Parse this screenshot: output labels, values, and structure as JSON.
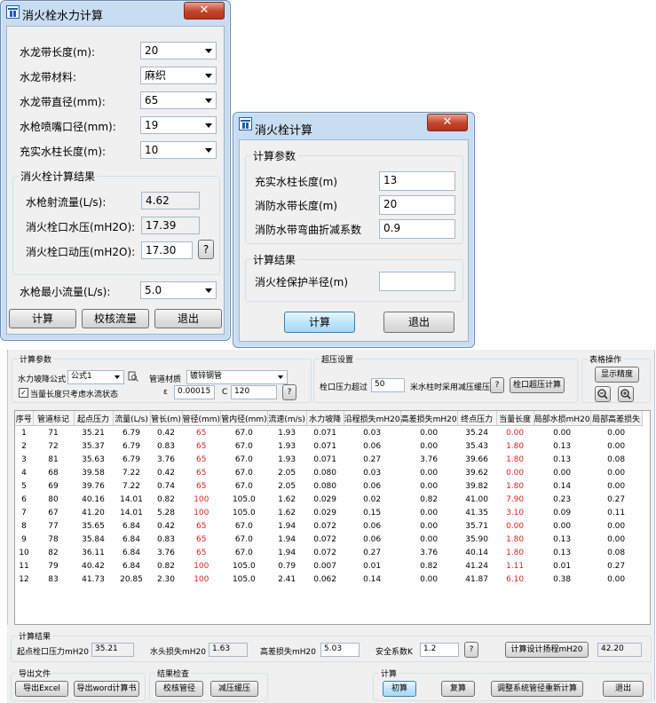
{
  "win1": {
    "title": "消火栓水力计算",
    "close": "✕",
    "hose_length": {
      "label": "水龙带长度(m):",
      "value": "20"
    },
    "hose_material": {
      "label": "水龙带材料:",
      "value": "麻织"
    },
    "hose_diameter": {
      "label": "水龙带直径(mm):",
      "value": "65"
    },
    "nozzle_diameter": {
      "label": "水枪喷嘴口径(mm):",
      "value": "19"
    },
    "water_column": {
      "label": "充实水柱长度(m):",
      "value": "10"
    },
    "results_title": "消火栓计算结果",
    "flow": {
      "label": "水枪射流量(L/s):",
      "value": "4.62"
    },
    "static_pressure": {
      "label": "消火栓口水压(mH2O):",
      "value": "17.39"
    },
    "dynamic_pressure": {
      "label": "消火栓口动压(mH2O):",
      "value": "17.30"
    },
    "help": "?",
    "min_flow": {
      "label": "水枪最小流量(L/s):",
      "value": "5.0"
    },
    "btn_calc": "计算",
    "btn_check": "校核流量",
    "btn_exit": "退出"
  },
  "win2": {
    "title": "消火栓计算",
    "close": "✕",
    "params_title": "计算参数",
    "water_column": {
      "label": "充实水柱长度(m)",
      "value": "13"
    },
    "hose_length": {
      "label": "消防水带长度(m)",
      "value": "20"
    },
    "bend_factor": {
      "label": "消防水带弯曲折减系数",
      "value": "0.9"
    },
    "results_title": "计算结果",
    "radius": {
      "label": "消火栓保护半径(m)",
      "value": ""
    },
    "btn_calc": "计算",
    "btn_exit": "退出"
  },
  "win3": {
    "params_title": "计算参数",
    "formula_label": "水力坡降公式",
    "formula_value": "公式1",
    "material_label": "管道材质",
    "material_value": "镀锌钢管",
    "checkbox_label": "当量长度只考虑水流状态",
    "eps_label": "ε",
    "eps_value": "0.00015",
    "c_label": "C",
    "c_value": "120",
    "help": "?",
    "overpressure_title": "超压设置",
    "over_label": "栓口压力超过",
    "over_value": "50",
    "over_suffix": "米水柱时采用减压缓压",
    "over_btn": "栓口超压计算",
    "table_ops_title": "表格操作",
    "btn_precision": "显示精度",
    "columns": [
      "序号",
      "管道标记",
      "起点压力",
      "流量(L/s)",
      "管长(m)",
      "管径(mm)",
      "管内径(mm)",
      "流速(m/s)",
      "水力坡降",
      "沿程损失mH20",
      "高差损失mH20",
      "终点压力",
      "当量长度",
      "局部水损mH20",
      "局部高差损失"
    ],
    "rows": [
      [
        "1",
        "71",
        "35.21",
        "6.79",
        "0.42",
        "65",
        "67.0",
        "1.93",
        "0.071",
        "0.03",
        "0.00",
        "35.24",
        "0.00",
        "0.00",
        "0.00"
      ],
      [
        "2",
        "72",
        "35.37",
        "6.79",
        "0.83",
        "65",
        "67.0",
        "1.93",
        "0.071",
        "0.06",
        "0.00",
        "35.43",
        "1.80",
        "0.13",
        "0.00"
      ],
      [
        "3",
        "81",
        "35.63",
        "6.79",
        "3.76",
        "65",
        "67.0",
        "1.93",
        "0.071",
        "0.27",
        "3.76",
        "39.66",
        "1.80",
        "0.13",
        "0.08"
      ],
      [
        "4",
        "68",
        "39.58",
        "7.22",
        "0.42",
        "65",
        "67.0",
        "2.05",
        "0.080",
        "0.03",
        "0.00",
        "39.62",
        "0.00",
        "0.00",
        "0.00"
      ],
      [
        "5",
        "69",
        "39.76",
        "7.22",
        "0.74",
        "65",
        "67.0",
        "2.05",
        "0.080",
        "0.06",
        "0.00",
        "39.82",
        "1.80",
        "0.14",
        "0.00"
      ],
      [
        "6",
        "80",
        "40.16",
        "14.01",
        "0.82",
        "100",
        "105.0",
        "1.62",
        "0.029",
        "0.02",
        "0.82",
        "41.00",
        "7.90",
        "0.23",
        "0.27"
      ],
      [
        "7",
        "67",
        "41.20",
        "14.01",
        "5.28",
        "100",
        "105.0",
        "1.62",
        "0.029",
        "0.15",
        "0.00",
        "41.35",
        "3.10",
        "0.09",
        "0.11"
      ],
      [
        "8",
        "77",
        "35.65",
        "6.84",
        "0.42",
        "65",
        "67.0",
        "1.94",
        "0.072",
        "0.06",
        "0.00",
        "35.71",
        "0.00",
        "0.00",
        "0.00"
      ],
      [
        "9",
        "78",
        "35.84",
        "6.84",
        "0.83",
        "65",
        "67.0",
        "1.94",
        "0.072",
        "0.06",
        "0.00",
        "35.90",
        "1.80",
        "0.13",
        "0.00"
      ],
      [
        "10",
        "82",
        "36.11",
        "6.84",
        "3.76",
        "65",
        "67.0",
        "1.94",
        "0.072",
        "0.27",
        "3.76",
        "40.14",
        "1.80",
        "0.13",
        "0.08"
      ],
      [
        "11",
        "79",
        "40.42",
        "6.84",
        "0.82",
        "100",
        "105.0",
        "0.79",
        "0.007",
        "0.01",
        "0.82",
        "41.24",
        "1.11",
        "0.01",
        "0.27"
      ],
      [
        "12",
        "83",
        "41.73",
        "20.85",
        "2.30",
        "100",
        "105.0",
        "2.41",
        "0.062",
        "0.14",
        "0.00",
        "41.87",
        "6.10",
        "0.38",
        "0.00"
      ]
    ],
    "red_columns": [
      5,
      12
    ],
    "results_title": "计算结果",
    "start_pressure_label": "起点栓口压力mH20",
    "start_pressure_value": "35.21",
    "head_loss_label": "水头损失mH20",
    "head_loss_value": "1.63",
    "height_loss_label": "高差损失mH20",
    "height_loss_value": "5.03",
    "safety_label": "安全系数K",
    "safety_value": "1.2",
    "btn_design_head": "计算设计扬程mH20",
    "design_head_value": "42.20",
    "export_title": "导出文件",
    "btn_excel": "导出Excel",
    "btn_word": "导出word计算书",
    "check_title": "结果检查",
    "btn_check_pipe": "校核管径",
    "btn_reduce": "减压缓压",
    "calc_title": "计算",
    "btn_initial": "初算",
    "btn_recalc": "复算",
    "btn_adjust": "调整系统管径重新计算",
    "btn_exit": "退出"
  }
}
